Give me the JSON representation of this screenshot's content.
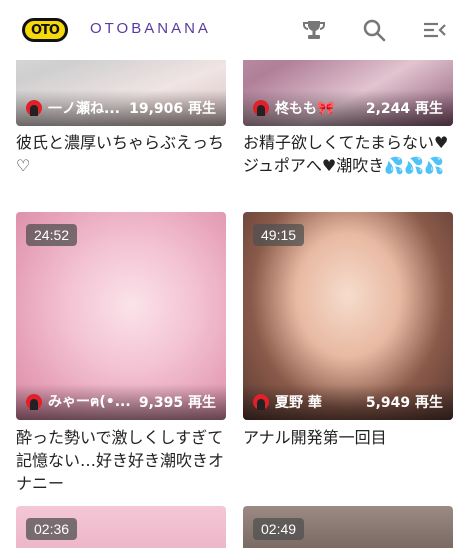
{
  "header": {
    "logo_text": "OTO",
    "brand": "OTOBANANA",
    "icons": [
      "trophy-icon",
      "search-icon",
      "menu-collapse-icon"
    ]
  },
  "cards": [
    {
      "duration": "",
      "user": "一ノ瀬ね...",
      "views": "19,906 再生",
      "title": "彼氏と濃厚いちゃらぶえっち♡"
    },
    {
      "duration": "",
      "user": "柊もも🎀",
      "views": "2,244 再生",
      "title": "お精子欲しくてたまらない♥ジュポアへ♥潮吹き💦💦💦"
    },
    {
      "duration": "24:52",
      "user": "みゃーฅ(•...",
      "views": "9,395 再生",
      "title": "酔った勢いで激しくしすぎて記憶ない…好き好き潮吹きオナニー"
    },
    {
      "duration": "49:15",
      "user": "夏野 華",
      "views": "5,949 再生",
      "title": "アナル開発第一回目"
    },
    {
      "duration": "02:36",
      "user": "",
      "views": "",
      "title": ""
    },
    {
      "duration": "02:49",
      "user": "",
      "views": "",
      "title": ""
    }
  ],
  "colors": {
    "brand": "#5b3aa0",
    "logo_bg": "#f5d90a",
    "avatar": "#e0202a"
  }
}
